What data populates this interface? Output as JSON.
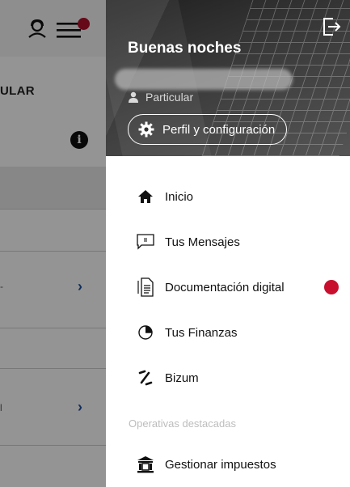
{
  "background_app": {
    "title": "ULAR",
    "info_glyph": "i",
    "chevron": "›",
    "fragment_1": "-",
    "fragment_2": "l"
  },
  "drawer": {
    "greeting": "Buenas noches",
    "profile_type": "Particular",
    "profile_button": "Perfil y configuración",
    "menu": [
      {
        "label": "Inicio",
        "icon": "home-icon"
      },
      {
        "label": "Tus Mensajes",
        "icon": "message-icon"
      },
      {
        "label": "Documentación digital",
        "icon": "document-icon",
        "notification": true
      },
      {
        "label": "Tus Finanzas",
        "icon": "pie-chart-icon"
      },
      {
        "label": "Bizum",
        "icon": "bizum-icon"
      }
    ],
    "section_title": "Operativas destacadas",
    "featured": [
      {
        "label": "Gestionar impuestos",
        "icon": "tax-building-icon"
      }
    ]
  },
  "colors": {
    "notification": "#c8102e",
    "chevron": "#1e4fa0"
  }
}
